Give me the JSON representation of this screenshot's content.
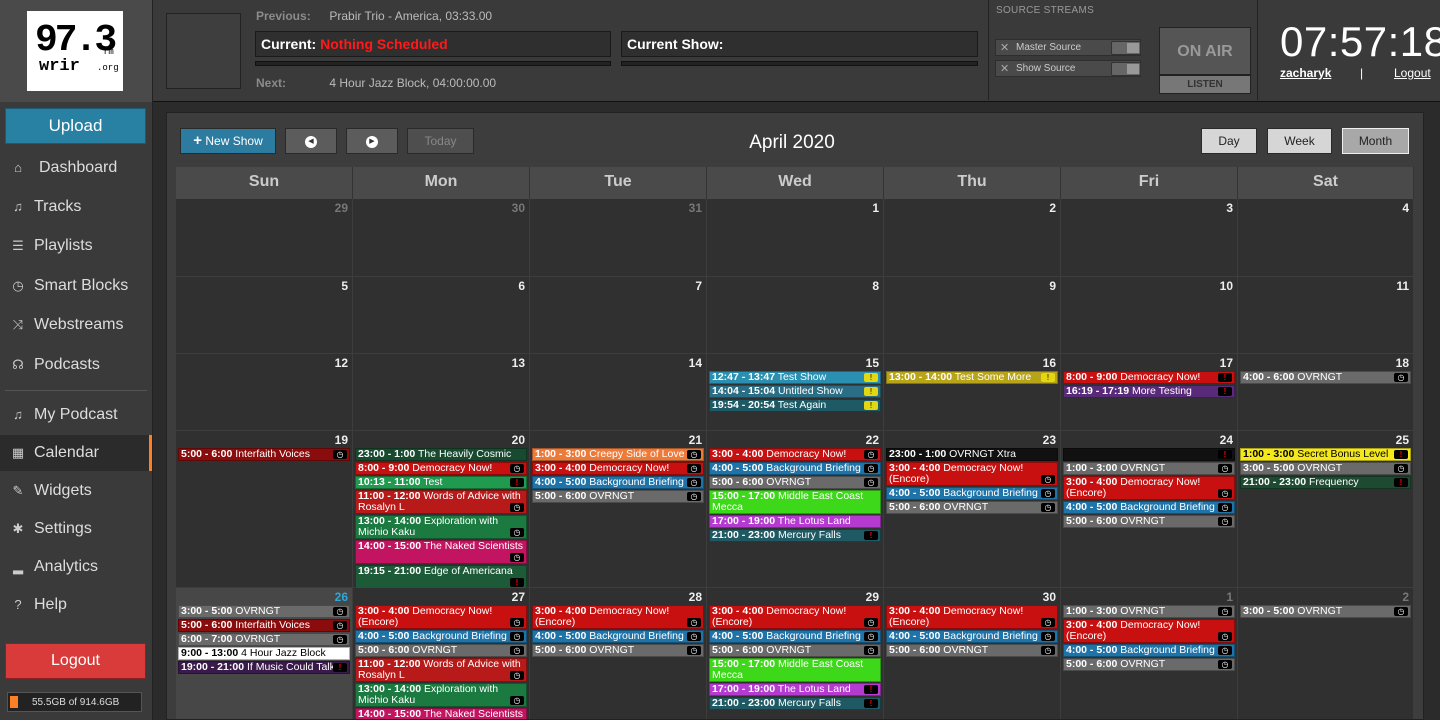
{
  "header": {
    "logo": {
      "freq": "97.3",
      "fm": "fm",
      "call": "wrir",
      "org": ".org"
    },
    "previous_label": "Previous:",
    "previous_value": "Prabir Trio - America, 03:33.00",
    "current_label": "Current:",
    "current_value": "Nothing Scheduled",
    "current_show_label": "Current Show:",
    "next_label": "Next:",
    "next_value": "4 Hour Jazz Block, 04:00:00.00",
    "source_streams_label": "SOURCE STREAMS",
    "master_source": "Master Source",
    "show_source": "Show Source",
    "on_air": "ON AIR",
    "listen": "LISTEN",
    "clock": "07:57:18",
    "user": "zacharyk",
    "separator": "|",
    "logout": "Logout"
  },
  "sidebar": {
    "upload": "Upload",
    "items": [
      {
        "label": "Dashboard",
        "icon": "home-icon",
        "glyph": "⌂"
      },
      {
        "label": "Tracks",
        "icon": "music-note-icon",
        "glyph": "♫"
      },
      {
        "label": "Playlists",
        "icon": "list-icon",
        "glyph": "☰"
      },
      {
        "label": "Smart Blocks",
        "icon": "clock-icon",
        "glyph": "◷"
      },
      {
        "label": "Webstreams",
        "icon": "shuffle-icon",
        "glyph": "⤨"
      },
      {
        "label": "Podcasts",
        "icon": "headphones-icon",
        "glyph": "☊"
      },
      {
        "label": "My Podcast",
        "icon": "music-note-icon",
        "glyph": "♫"
      },
      {
        "label": "Calendar",
        "icon": "calendar-icon",
        "glyph": "▦",
        "active": true
      },
      {
        "label": "Widgets",
        "icon": "wrench-icon",
        "glyph": "✎"
      },
      {
        "label": "Settings",
        "icon": "gear-icon",
        "glyph": "✱"
      },
      {
        "label": "Analytics",
        "icon": "signal-icon",
        "glyph": "▂"
      },
      {
        "label": "Help",
        "icon": "help-icon",
        "glyph": "?"
      }
    ],
    "logout": "Logout",
    "disk_usage": "55.5GB of 914.6GB",
    "disk_fraction": 0.0607
  },
  "calendar": {
    "title": "April 2020",
    "new_show": "New Show",
    "today": "Today",
    "view_day": "Day",
    "view_week": "Week",
    "view_month": "Month",
    "days_of_week": [
      "Sun",
      "Mon",
      "Tue",
      "Wed",
      "Thu",
      "Fri",
      "Sat"
    ],
    "weeks": [
      [
        {
          "day": "29",
          "other": true,
          "events": []
        },
        {
          "day": "30",
          "other": true,
          "events": []
        },
        {
          "day": "31",
          "other": true,
          "events": []
        },
        {
          "day": "1",
          "events": []
        },
        {
          "day": "2",
          "events": []
        },
        {
          "day": "3",
          "events": []
        },
        {
          "day": "4",
          "events": []
        }
      ],
      [
        {
          "day": "5",
          "events": []
        },
        {
          "day": "6",
          "events": []
        },
        {
          "day": "7",
          "events": []
        },
        {
          "day": "8",
          "events": []
        },
        {
          "day": "9",
          "events": []
        },
        {
          "day": "10",
          "events": []
        },
        {
          "day": "11",
          "events": []
        }
      ],
      [
        {
          "day": "12",
          "events": []
        },
        {
          "day": "13",
          "events": []
        },
        {
          "day": "14",
          "events": []
        },
        {
          "day": "15",
          "events": [
            {
              "time": "12:47 - 13:47",
              "title": "Test Show",
              "color": "#2a8fb0",
              "status": "warn"
            },
            {
              "time": "14:04 - 15:04",
              "title": "Untitled Show",
              "color": "#2a6e86",
              "status": "warn"
            },
            {
              "time": "19:54 - 20:54",
              "title": "Test Again",
              "color": "#1e5a66",
              "status": "warn"
            }
          ]
        },
        {
          "day": "16",
          "events": [
            {
              "time": "13:00 - 14:00",
              "title": "Test Some More",
              "color": "#b8a418",
              "status": "warn"
            }
          ]
        },
        {
          "day": "17",
          "events": [
            {
              "time": "8:00 - 9:00",
              "title": "Democracy Now!",
              "color": "#c81010",
              "status": "err"
            },
            {
              "time": "16:19 - 17:19",
              "title": "More Testing",
              "color": "#5a2a7a",
              "status": "err"
            }
          ]
        },
        {
          "day": "18",
          "events": [
            {
              "time": "4:00 - 6:00",
              "title": "OVRNGT",
              "color": "#6a6a6a",
              "status": "ok"
            }
          ]
        }
      ],
      [
        {
          "day": "19",
          "events": [
            {
              "time": "5:00 - 6:00",
              "title": "Interfaith Voices",
              "color": "#8a0c0c",
              "status": "ok"
            }
          ]
        },
        {
          "day": "20",
          "events": [
            {
              "time": "23:00 - 1:00",
              "title": "The Heavily Cosmic Rotation",
              "color": "#184a30",
              "status": ""
            },
            {
              "time": "8:00 - 9:00",
              "title": "Democracy Now!",
              "color": "#c81010",
              "status": "ok"
            },
            {
              "time": "10:13 - 11:00",
              "title": "Test",
              "color": "#1f9a4e",
              "status": "err"
            },
            {
              "time": "11:00 - 12:00",
              "title": "Words of Advice with Rosalyn L",
              "color": "#b81a1a",
              "status": "ok",
              "tall": true
            },
            {
              "time": "13:00 - 14:00",
              "title": "Exploration with Michio Kaku",
              "color": "#1a7a40",
              "status": "ok",
              "tall": true
            },
            {
              "time": "14:00 - 15:00",
              "title": "The Naked Scientists",
              "color": "#c21460",
              "status": "ok",
              "tall": true
            },
            {
              "time": "19:15 - 21:00",
              "title": "Edge of Americana",
              "color": "#1d5a38",
              "status": "err",
              "tall": true
            }
          ]
        },
        {
          "day": "21",
          "events": [
            {
              "time": "1:00 - 3:00",
              "title": "Creepy Side of Love",
              "color": "#ee7a3a",
              "status": "ok"
            },
            {
              "time": "3:00 - 4:00",
              "title": "Democracy Now!",
              "color": "#c81010",
              "status": "ok"
            },
            {
              "time": "4:00 - 5:00",
              "title": "Background Briefing",
              "color": "#1e73a8",
              "status": "ok"
            },
            {
              "time": "5:00 - 6:00",
              "title": "OVRNGT",
              "color": "#6a6a6a",
              "status": "ok"
            }
          ]
        },
        {
          "day": "22",
          "events": [
            {
              "time": "3:00 - 4:00",
              "title": "Democracy Now!",
              "color": "#c81010",
              "status": "ok"
            },
            {
              "time": "4:00 - 5:00",
              "title": "Background Briefing",
              "color": "#1e73a8",
              "status": "ok"
            },
            {
              "time": "5:00 - 6:00",
              "title": "OVRNGT",
              "color": "#6a6a6a",
              "status": "ok"
            },
            {
              "time": "15:00 - 17:00",
              "title": "Middle East Coast Mecca",
              "color": "#3ed81a",
              "status": "",
              "tall": true
            },
            {
              "time": "17:00 - 19:00",
              "title": "The Lotus Land Show",
              "color": "#b43ad0",
              "status": ""
            },
            {
              "time": "21:00 - 23:00",
              "title": "Mercury Falls",
              "color": "#1f5a64",
              "status": "err"
            }
          ]
        },
        {
          "day": "23",
          "events": [
            {
              "time": "23:00 - 1:00",
              "title": "OVRNGT Xtra",
              "color": "#111111",
              "status": ""
            },
            {
              "time": "3:00 - 4:00",
              "title": "Democracy Now! (Encore)",
              "color": "#c81010",
              "status": "ok",
              "tall": true
            },
            {
              "time": "4:00 - 5:00",
              "title": "Background Briefing",
              "color": "#1e73a8",
              "status": "ok"
            },
            {
              "time": "5:00 - 6:00",
              "title": "OVRNGT",
              "color": "#6a6a6a",
              "status": "ok"
            }
          ]
        },
        {
          "day": "24",
          "events": [
            {
              "time": "",
              "title": "",
              "color": "#111111",
              "status": "err"
            },
            {
              "time": "1:00 - 3:00",
              "title": "OVRNGT",
              "color": "#6a6a6a",
              "status": "ok"
            },
            {
              "time": "3:00 - 4:00",
              "title": "Democracy Now! (Encore)",
              "color": "#c81010",
              "status": "ok",
              "tall": true
            },
            {
              "time": "4:00 - 5:00",
              "title": "Background Briefing",
              "color": "#1e73a8",
              "status": "ok"
            },
            {
              "time": "5:00 - 6:00",
              "title": "OVRNGT",
              "color": "#6a6a6a",
              "status": "ok"
            }
          ]
        },
        {
          "day": "25",
          "events": [
            {
              "time": "1:00 - 3:00",
              "title": "Secret Bonus Level",
              "color": "#f5e81a",
              "dark": true,
              "status": "err"
            },
            {
              "time": "3:00 - 5:00",
              "title": "OVRNGT",
              "color": "#6a6a6a",
              "status": "ok"
            },
            {
              "time": "21:00 - 23:00",
              "title": "Frequency",
              "color": "#1d4a30",
              "status": "err"
            }
          ]
        }
      ],
      [
        {
          "day": "26",
          "today": true,
          "events": [
            {
              "time": "3:00 - 5:00",
              "title": "OVRNGT",
              "color": "#6a6a6a",
              "status": "ok"
            },
            {
              "time": "5:00 - 6:00",
              "title": "Interfaith Voices",
              "color": "#8a0c0c",
              "status": "ok"
            },
            {
              "time": "6:00 - 7:00",
              "title": "OVRNGT",
              "color": "#6a6a6a",
              "status": "ok"
            },
            {
              "time": "9:00 - 13:00",
              "title": "4 Hour Jazz Block",
              "color": "#ffffff",
              "dark": true,
              "status": ""
            },
            {
              "time": "19:00 - 21:00",
              "title": "If Music Could Talk",
              "color": "#3a1a4a",
              "status": "err"
            }
          ]
        },
        {
          "day": "27",
          "events": [
            {
              "time": "3:00 - 4:00",
              "title": "Democracy Now! (Encore)",
              "color": "#c81010",
              "status": "ok",
              "tall": true
            },
            {
              "time": "4:00 - 5:00",
              "title": "Background Briefing",
              "color": "#1e73a8",
              "status": "ok"
            },
            {
              "time": "5:00 - 6:00",
              "title": "OVRNGT",
              "color": "#6a6a6a",
              "status": "ok"
            },
            {
              "time": "11:00 - 12:00",
              "title": "Words of Advice with Rosalyn L",
              "color": "#b81a1a",
              "status": "ok",
              "tall": true
            },
            {
              "time": "13:00 - 14:00",
              "title": "Exploration with Michio Kaku",
              "color": "#1a7a40",
              "status": "ok",
              "tall": true
            },
            {
              "time": "14:00 - 15:00",
              "title": "The Naked Scientists",
              "color": "#c21460",
              "status": ""
            }
          ]
        },
        {
          "day": "28",
          "events": [
            {
              "time": "3:00 - 4:00",
              "title": "Democracy Now! (Encore)",
              "color": "#c81010",
              "status": "ok",
              "tall": true
            },
            {
              "time": "4:00 - 5:00",
              "title": "Background Briefing",
              "color": "#1e73a8",
              "status": "ok"
            },
            {
              "time": "5:00 - 6:00",
              "title": "OVRNGT",
              "color": "#6a6a6a",
              "status": "ok"
            }
          ]
        },
        {
          "day": "29",
          "events": [
            {
              "time": "3:00 - 4:00",
              "title": "Democracy Now! (Encore)",
              "color": "#c81010",
              "status": "ok",
              "tall": true
            },
            {
              "time": "4:00 - 5:00",
              "title": "Background Briefing",
              "color": "#1e73a8",
              "status": "ok"
            },
            {
              "time": "5:00 - 6:00",
              "title": "OVRNGT",
              "color": "#6a6a6a",
              "status": "ok"
            },
            {
              "time": "15:00 - 17:00",
              "title": "Middle East Coast Mecca",
              "color": "#3ed81a",
              "status": "",
              "tall": true
            },
            {
              "time": "17:00 - 19:00",
              "title": "The Lotus Land Show",
              "color": "#b43ad0",
              "status": "err"
            },
            {
              "time": "21:00 - 23:00",
              "title": "Mercury Falls",
              "color": "#1f5a64",
              "status": "err"
            }
          ]
        },
        {
          "day": "30",
          "events": [
            {
              "time": "3:00 - 4:00",
              "title": "Democracy Now! (Encore)",
              "color": "#c81010",
              "status": "ok",
              "tall": true
            },
            {
              "time": "4:00 - 5:00",
              "title": "Background Briefing",
              "color": "#1e73a8",
              "status": "ok"
            },
            {
              "time": "5:00 - 6:00",
              "title": "OVRNGT",
              "color": "#6a6a6a",
              "status": "ok"
            }
          ]
        },
        {
          "day": "1",
          "other": true,
          "events": [
            {
              "time": "1:00 - 3:00",
              "title": "OVRNGT",
              "color": "#6a6a6a",
              "status": "ok"
            },
            {
              "time": "3:00 - 4:00",
              "title": "Democracy Now! (Encore)",
              "color": "#c81010",
              "status": "ok",
              "tall": true
            },
            {
              "time": "4:00 - 5:00",
              "title": "Background Briefing",
              "color": "#1e73a8",
              "status": "ok"
            },
            {
              "time": "5:00 - 6:00",
              "title": "OVRNGT",
              "color": "#6a6a6a",
              "status": "ok"
            }
          ]
        },
        {
          "day": "2",
          "other": true,
          "events": [
            {
              "time": "3:00 - 5:00",
              "title": "OVRNGT",
              "color": "#6a6a6a",
              "status": "ok"
            }
          ]
        }
      ]
    ]
  }
}
